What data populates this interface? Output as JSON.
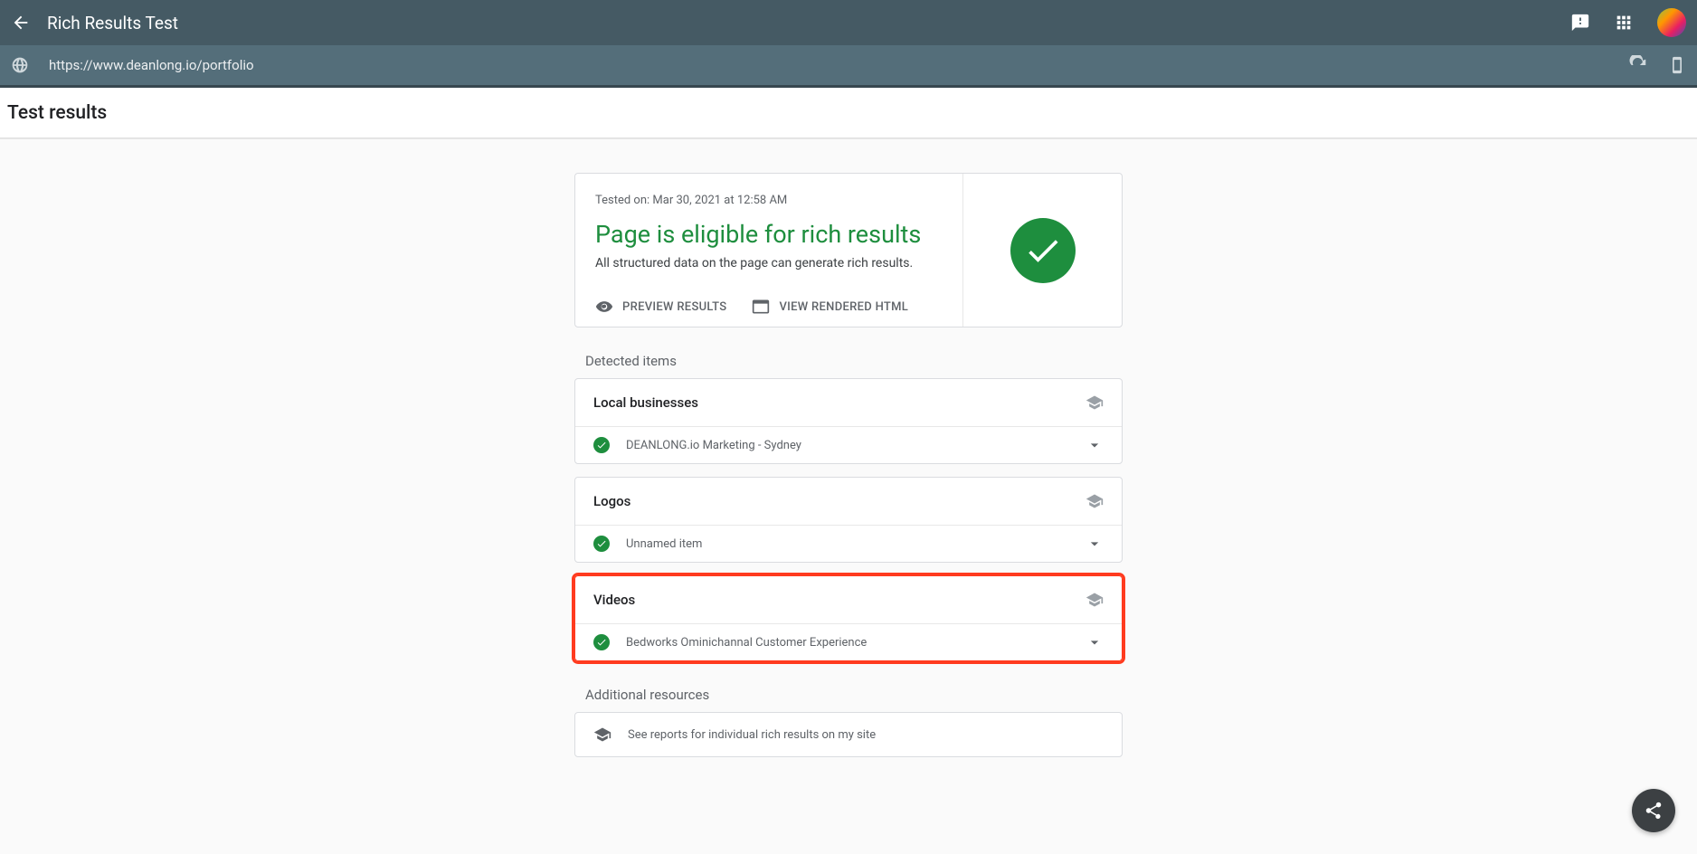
{
  "topbar": {
    "title": "Rich Results Test"
  },
  "urlbar": {
    "url": "https://www.deanlong.io/portfolio"
  },
  "section_header": "Test results",
  "status": {
    "tested_on": "Tested on: Mar 30, 2021 at 12:58 AM",
    "headline": "Page is eligible for rich results",
    "subline": "All structured data on the page can generate rich results.",
    "preview_label": "PREVIEW RESULTS",
    "view_html_label": "VIEW RENDERED HTML"
  },
  "detected_label": "Detected items",
  "items": [
    {
      "title": "Local businesses",
      "row": "DEANLONG.io Marketing - Sydney"
    },
    {
      "title": "Logos",
      "row": "Unnamed item"
    },
    {
      "title": "Videos",
      "row": "Bedworks Ominichannal Customer Experience"
    }
  ],
  "additional_label": "Additional resources",
  "additional_row": "See reports for individual rich results on my site"
}
